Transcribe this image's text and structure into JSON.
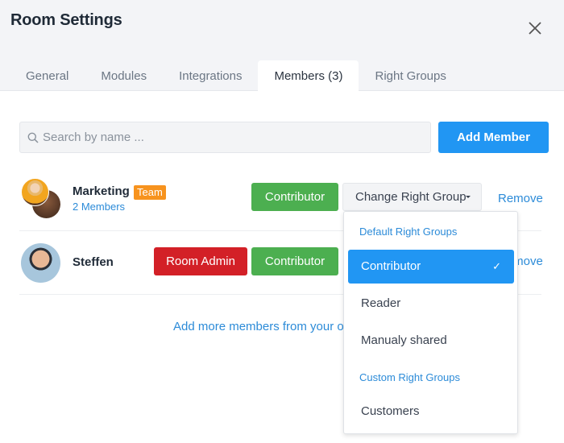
{
  "dialog": {
    "title": "Room Settings",
    "close_icon": "close-icon"
  },
  "tabs": [
    {
      "label": "General",
      "active": false
    },
    {
      "label": "Modules",
      "active": false
    },
    {
      "label": "Integrations",
      "active": false
    },
    {
      "label": "Members (3)",
      "active": true
    },
    {
      "label": "Right Groups",
      "active": false
    }
  ],
  "search": {
    "placeholder": "Search by name ...",
    "value": "",
    "icon": "search-icon"
  },
  "add_member_label": "Add Member",
  "members": [
    {
      "name": "Marketing",
      "badge": "Team",
      "subtitle": "2 Members",
      "roles": [
        "Contributor"
      ],
      "change_label": "Change Right Group",
      "remove_label": "Remove"
    },
    {
      "name": "Steffen",
      "roles": [
        "Room Admin",
        "Contributor"
      ],
      "remove_label": "Remove"
    }
  ],
  "add_more_link": "Add more members from your o",
  "dropdown": {
    "default_header": "Default Right Groups",
    "default_items": [
      {
        "label": "Contributor",
        "selected": true
      },
      {
        "label": "Reader",
        "selected": false
      },
      {
        "label": "Manualy shared",
        "selected": false
      }
    ],
    "custom_header": "Custom Right Groups",
    "custom_items": [
      {
        "label": "Customers",
        "selected": false
      }
    ],
    "check_icon": "✓"
  },
  "colors": {
    "primary": "#2196f3",
    "contributor": "#4caf50",
    "room_admin": "#d32027",
    "team_badge": "#f7931e",
    "link": "#2c8bd8"
  }
}
